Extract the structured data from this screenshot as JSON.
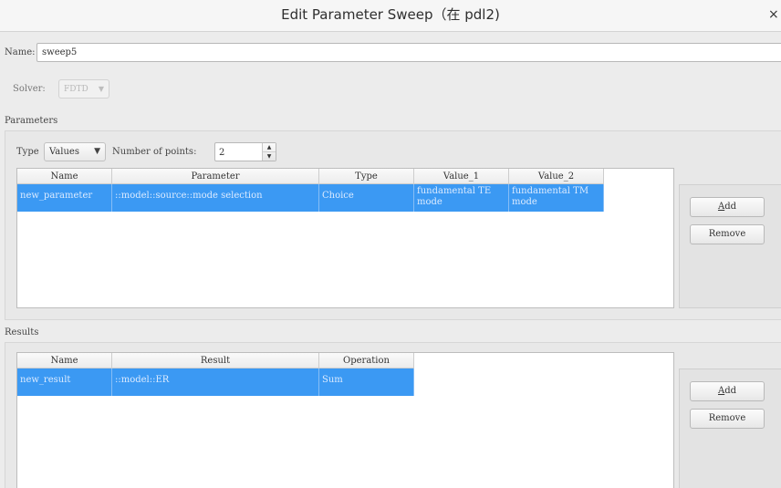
{
  "window": {
    "title": "Edit Parameter Sweep（在 pdl2)",
    "close_glyph": "×"
  },
  "name": {
    "label": "Name:",
    "value": "sweep5"
  },
  "solver": {
    "label": "Solver:",
    "value": "FDTD"
  },
  "parameters": {
    "section_label": "Parameters",
    "type_label": "Type",
    "type_value": "Values",
    "points_label": "Number of points:",
    "points_value": "2",
    "columns": [
      "Name",
      "Parameter",
      "Type",
      "Value_1",
      "Value_2"
    ],
    "rows": [
      {
        "name": "new_parameter",
        "parameter": "::model::source::mode selection",
        "type": "Choice",
        "value_1": "fundamental TE mode",
        "value_2": "fundamental TM mode"
      }
    ],
    "add_label_key": "A",
    "add_label_rest": "dd",
    "remove_label": "Remove"
  },
  "results": {
    "section_label": "Results",
    "columns": [
      "Name",
      "Result",
      "Operation"
    ],
    "rows": [
      {
        "name": "new_result",
        "result": "::model::ER",
        "operation": "Sum"
      }
    ],
    "add_label_key": "A",
    "add_label_rest": "dd",
    "remove_label": "Remove"
  },
  "colors": {
    "selection": "#3b99f3",
    "window_bg": "#ececec"
  },
  "icons": {
    "dropdown": "triangle-down",
    "spin_up": "triangle-up",
    "spin_down": "triangle-down"
  }
}
